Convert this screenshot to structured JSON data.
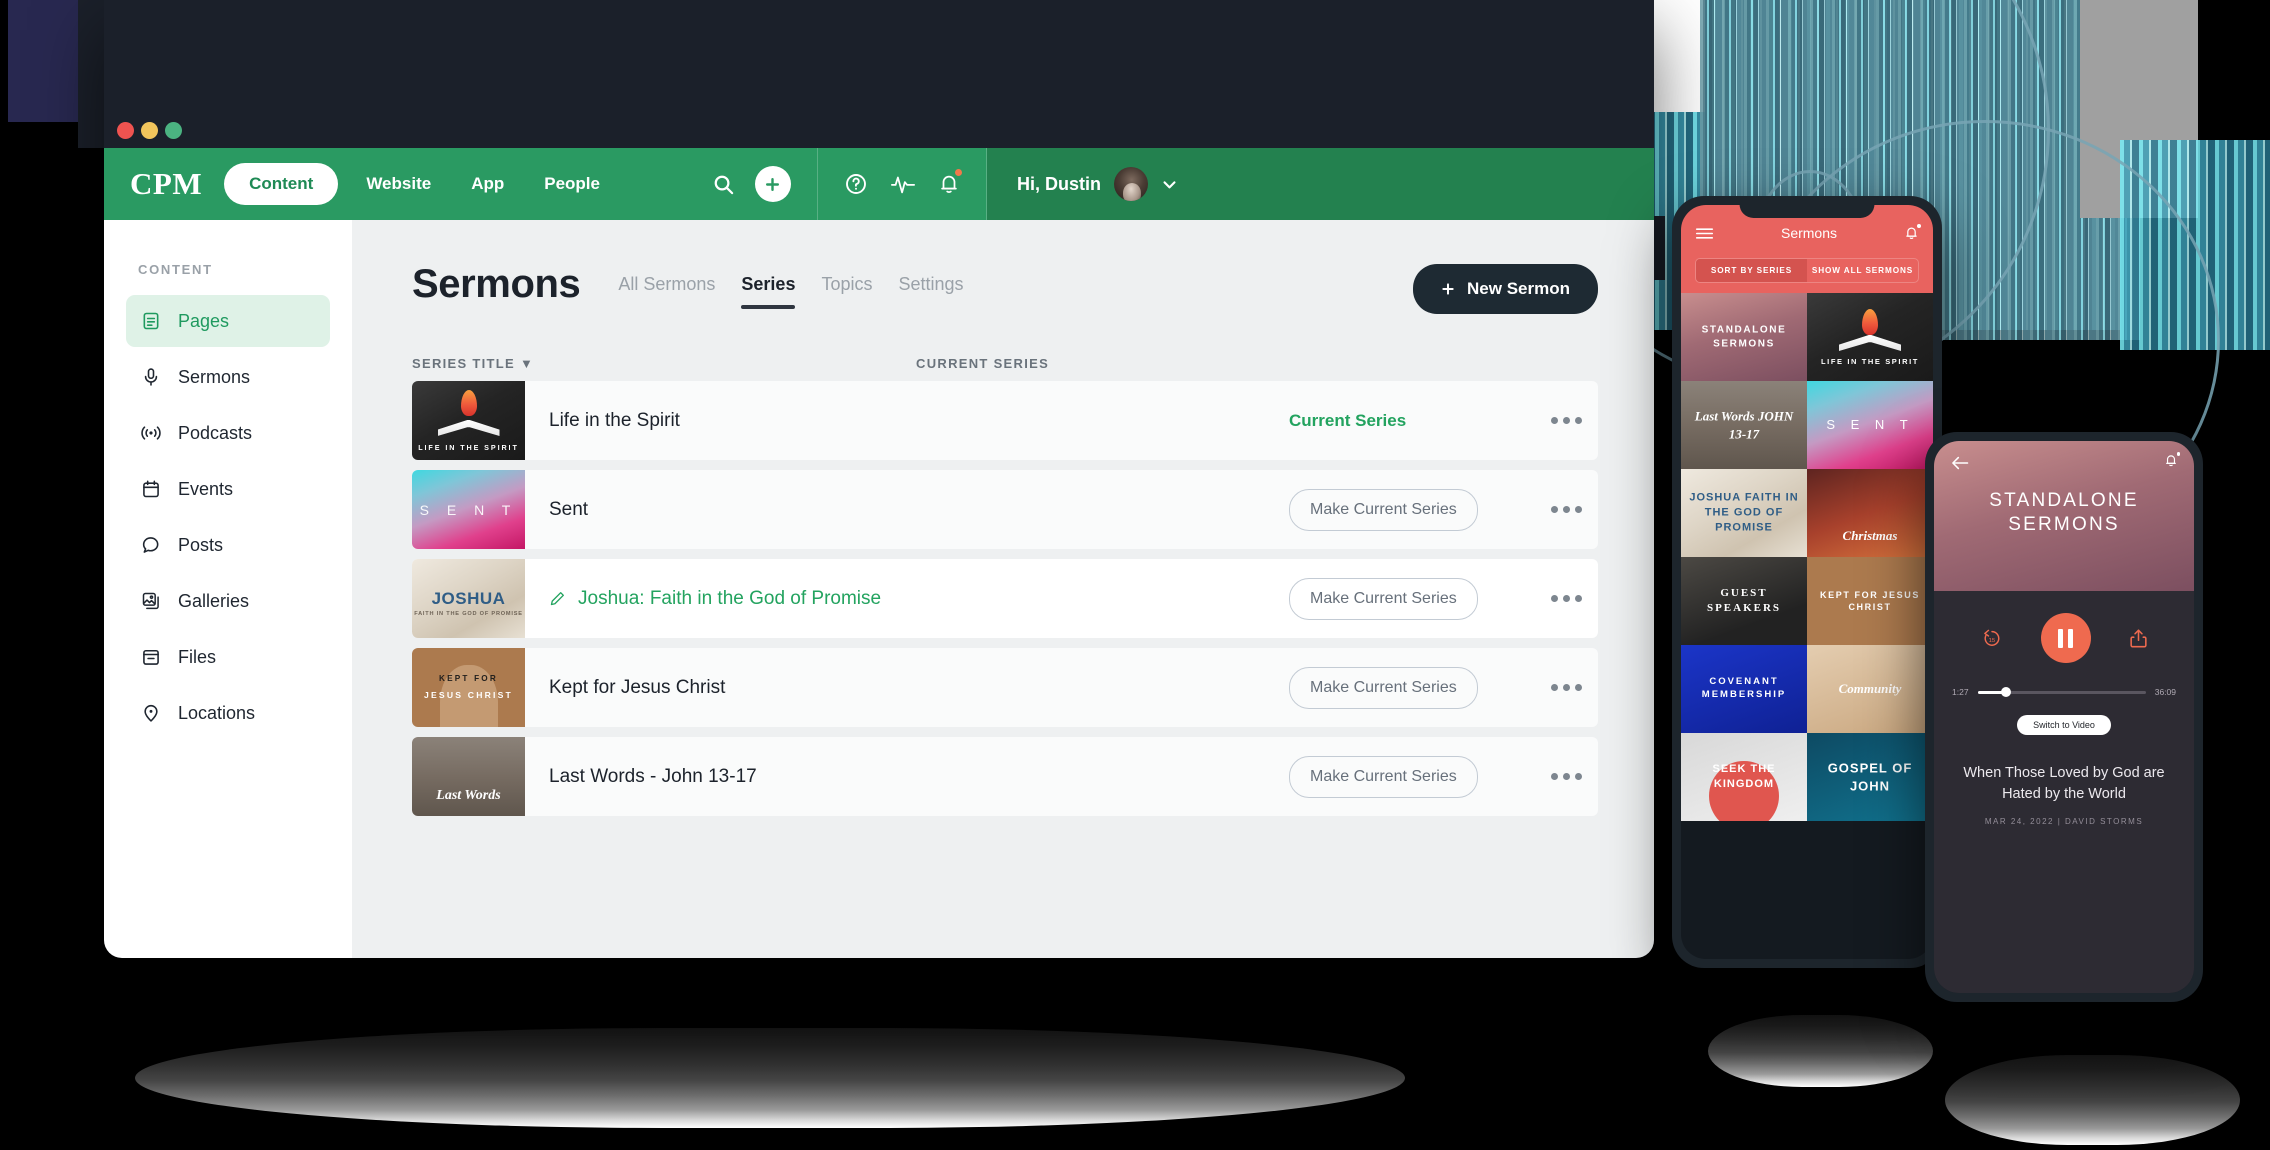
{
  "window": {
    "traffic_lights": [
      "close",
      "minimize",
      "maximize"
    ]
  },
  "header": {
    "brand": "CPM",
    "nav": [
      {
        "label": "Content",
        "active": true
      },
      {
        "label": "Website",
        "active": false
      },
      {
        "label": "App",
        "active": false
      },
      {
        "label": "People",
        "active": false
      }
    ],
    "icons": [
      "search-icon",
      "add-icon",
      "help-icon",
      "activity-icon",
      "bell-icon"
    ],
    "greeting": "Hi, Dustin",
    "accent_green": "#2a9a62",
    "accent_green_dark": "#23814f",
    "notification_dot_color": "#f2784b"
  },
  "sidebar": {
    "section_label": "CONTENT",
    "items": [
      {
        "label": "Pages",
        "icon": "pages-icon",
        "active": true
      },
      {
        "label": "Sermons",
        "icon": "microphone-icon",
        "active": false
      },
      {
        "label": "Podcasts",
        "icon": "broadcast-icon",
        "active": false
      },
      {
        "label": "Events",
        "icon": "calendar-icon",
        "active": false
      },
      {
        "label": "Posts",
        "icon": "comment-icon",
        "active": false
      },
      {
        "label": "Galleries",
        "icon": "images-icon",
        "active": false
      },
      {
        "label": "Files",
        "icon": "archive-icon",
        "active": false
      },
      {
        "label": "Locations",
        "icon": "map-pin-icon",
        "active": false
      }
    ]
  },
  "main": {
    "title": "Sermons",
    "tabs": [
      {
        "label": "All Sermons",
        "active": false
      },
      {
        "label": "Series",
        "active": true
      },
      {
        "label": "Topics",
        "active": false
      },
      {
        "label": "Settings",
        "active": false
      }
    ],
    "new_button": "New Sermon",
    "new_button_icon": "plus-icon",
    "columns": {
      "title": "SERIES TITLE",
      "sort_indicator": "▼",
      "status": "CURRENT SERIES"
    },
    "make_current_label": "Make Current Series",
    "current_series_label": "Current Series",
    "current_series_color": "#23a35f",
    "rows": [
      {
        "title": "Life in the Spirit",
        "art": "art-lifeinthespirit",
        "art_caption": "LIFE IN THE SPIRIT",
        "is_current": true,
        "editing": false
      },
      {
        "title": "Sent",
        "art": "art-sent",
        "art_caption": "S E N T",
        "is_current": false,
        "editing": false
      },
      {
        "title": "Joshua: Faith in the God of Promise",
        "art": "art-joshua",
        "art_caption": "JOSHUA",
        "art_subcaption": "FAITH IN THE GOD OF PROMISE",
        "is_current": false,
        "editing": true
      },
      {
        "title": "Kept for Jesus Christ",
        "art": "art-kept",
        "art_caption": "KEPT FOR",
        "art_subcaption": "JESUS CHRIST",
        "is_current": false,
        "editing": false
      },
      {
        "title": "Last Words - John 13-17",
        "art": "art-lastwords",
        "art_caption": "Last Words",
        "is_current": false,
        "editing": false
      }
    ]
  },
  "phone_list": {
    "menu_icon": "hamburger-icon",
    "title": "Sermons",
    "bell_icon": "bell-icon",
    "segments": [
      {
        "label": "SORT BY SERIES",
        "active": true
      },
      {
        "label": "SHOW ALL SERMONS",
        "active": false
      }
    ],
    "accent": "#e8635f",
    "tiles": [
      {
        "label": "STANDALONE SERMONS",
        "art": "art-standalone"
      },
      {
        "label": "LIFE IN THE SPIRIT",
        "art": "art-lifeinthespirit"
      },
      {
        "label": "Last Words JOHN 13-17",
        "art": "art-lastwords"
      },
      {
        "label": "S E N T",
        "art": "art-sent"
      },
      {
        "label": "JOSHUA FAITH IN THE GOD OF PROMISE",
        "art": "art-joshua"
      },
      {
        "label": "Christmas",
        "art": "art-christ"
      },
      {
        "label": "GUEST SPEAKERS",
        "art": "art-guest"
      },
      {
        "label": "KEPT FOR JESUS CHRIST",
        "art": "art-kept"
      },
      {
        "label": "COVENANT MEMBERSHIP",
        "art": "art-cov"
      },
      {
        "label": "Community",
        "art": "art-comm"
      },
      {
        "label": "SEEK THE KINGDOM",
        "art": "art-seek"
      },
      {
        "label": "GOSPEL OF JOHN",
        "art": "art-gospel"
      }
    ]
  },
  "phone_player": {
    "back_icon": "back-arrow-icon",
    "bell_icon": "bell-icon",
    "series_title": "STANDALONE SERMONS",
    "rewind_icon": "rewind-15-icon",
    "play_icon": "pause-icon",
    "share_icon": "share-icon",
    "time_elapsed": "1:27",
    "time_total": "36:09",
    "switch_label": "Switch to Video",
    "sermon_title": "When Those Loved by God are Hated by the World",
    "sermon_meta": "MAR 24, 2022  |  DAVID STORMS",
    "accent": "#ef6a4f"
  }
}
